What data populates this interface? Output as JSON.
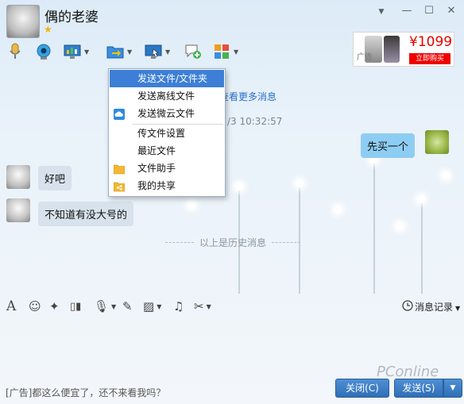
{
  "window": {
    "contact_name": "偶的老婆",
    "controls": [
      "▼",
      "—",
      "☐",
      "✕"
    ]
  },
  "ad": {
    "tag": "广告",
    "price": "¥1099",
    "buy_label": "立即购买"
  },
  "chat": {
    "partial_text_1": "查看更多消息",
    "partial_timestamp": "/3 10:32:57",
    "messages": [
      {
        "side": "right",
        "text": "先买一个"
      },
      {
        "side": "left",
        "text": "好吧"
      },
      {
        "side": "left",
        "text": "不知道有没大号的"
      }
    ],
    "history_divider": "以上是历史消息"
  },
  "menu": {
    "items": [
      {
        "label": "发送文件/文件夹",
        "selected": true,
        "icon": ""
      },
      {
        "label": "发送离线文件",
        "selected": false,
        "icon": ""
      },
      {
        "label": "发送微云文件",
        "selected": false,
        "icon": "cloud-icon"
      },
      {
        "label": "传文件设置",
        "selected": false,
        "icon": ""
      },
      {
        "label": "最近文件",
        "selected": false,
        "icon": ""
      },
      {
        "label": "文件助手",
        "selected": false,
        "icon": "folder-icon"
      },
      {
        "label": "我的共享",
        "selected": false,
        "icon": "share-folder-icon"
      }
    ]
  },
  "input_toolbar": {
    "record_label": "消息记录"
  },
  "footer": {
    "ad_text": "[广告]都这么便宜了，还不来看我吗？",
    "close_label": "关闭(C)",
    "send_label": "发送(S)",
    "watermark": "PConline"
  },
  "colors": {
    "menu_selected": "#3d7fd6",
    "right_bubble": "#8ecdf3",
    "left_bubble": "#d7e2ec",
    "ad_price": "#e40000"
  }
}
